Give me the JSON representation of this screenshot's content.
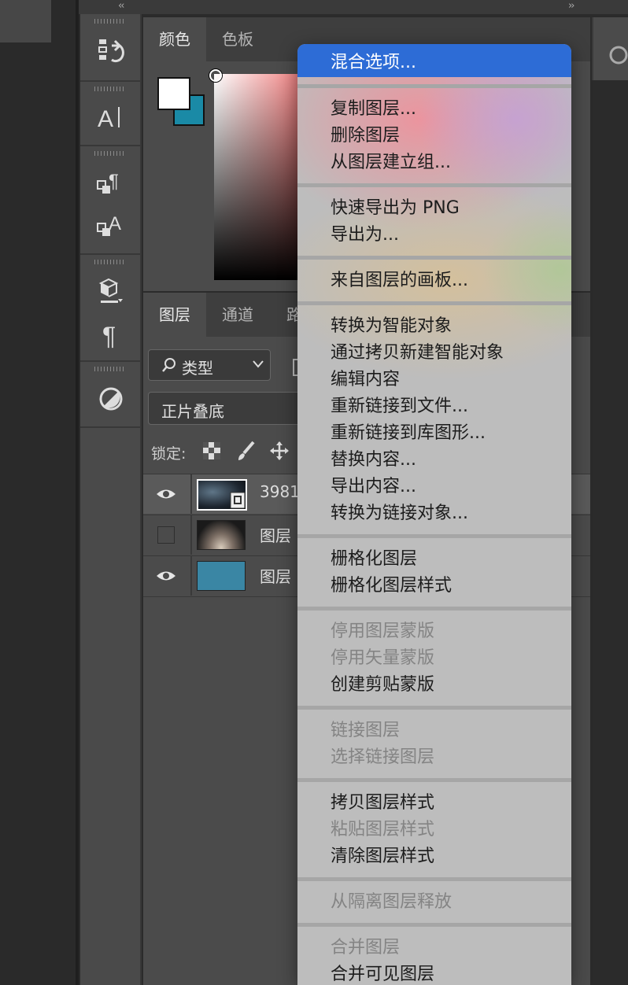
{
  "color_panel": {
    "tabs": [
      "颜色",
      "色板"
    ],
    "foreground_color": "#ffffff",
    "background_color": "#1a8aa6"
  },
  "layers_panel": {
    "tabs": [
      "图层",
      "通道",
      "路"
    ],
    "filter_label": "类型",
    "blend_mode": "正片叠底",
    "lock_label": "锁定:",
    "layers": [
      {
        "name": "3981",
        "visible": true,
        "selected": true,
        "thumb": "smart-object"
      },
      {
        "name": "图层",
        "visible": false,
        "selected": false,
        "thumb": "spotlight"
      },
      {
        "name": "图层",
        "visible": true,
        "selected": false,
        "thumb": "#3a86a4"
      }
    ]
  },
  "context_menu": {
    "groups": [
      [
        {
          "label": "混合选项...",
          "enabled": true,
          "highlighted": true
        }
      ],
      [
        {
          "label": "复制图层...",
          "enabled": true
        },
        {
          "label": "删除图层",
          "enabled": true
        },
        {
          "label": "从图层建立组...",
          "enabled": true
        }
      ],
      [
        {
          "label": "快速导出为 PNG",
          "enabled": true
        },
        {
          "label": "导出为...",
          "enabled": true
        }
      ],
      [
        {
          "label": "来自图层的画板...",
          "enabled": true
        }
      ],
      [
        {
          "label": "转换为智能对象",
          "enabled": true
        },
        {
          "label": "通过拷贝新建智能对象",
          "enabled": true
        },
        {
          "label": "编辑内容",
          "enabled": true
        },
        {
          "label": "重新链接到文件...",
          "enabled": true
        },
        {
          "label": "重新链接到库图形...",
          "enabled": true
        },
        {
          "label": "替换内容...",
          "enabled": true
        },
        {
          "label": "导出内容...",
          "enabled": true
        },
        {
          "label": "转换为链接对象...",
          "enabled": true
        }
      ],
      [
        {
          "label": "栅格化图层",
          "enabled": true
        },
        {
          "label": "栅格化图层样式",
          "enabled": true
        }
      ],
      [
        {
          "label": "停用图层蒙版",
          "enabled": false
        },
        {
          "label": "停用矢量蒙版",
          "enabled": false
        },
        {
          "label": "创建剪贴蒙版",
          "enabled": true
        }
      ],
      [
        {
          "label": "链接图层",
          "enabled": false
        },
        {
          "label": "选择链接图层",
          "enabled": false
        }
      ],
      [
        {
          "label": "拷贝图层样式",
          "enabled": true
        },
        {
          "label": "粘贴图层样式",
          "enabled": false
        },
        {
          "label": "清除图层样式",
          "enabled": true
        }
      ],
      [
        {
          "label": "从隔离图层释放",
          "enabled": false
        }
      ],
      [
        {
          "label": "合并图层",
          "enabled": false
        },
        {
          "label": "合并可见图层",
          "enabled": true
        }
      ]
    ]
  }
}
